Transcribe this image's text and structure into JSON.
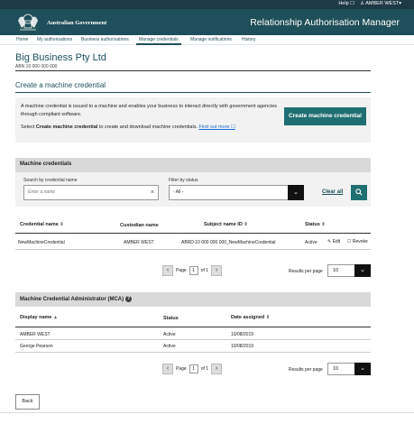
{
  "topbar": {
    "help": "Help ☐",
    "user": "♙ AMBER WEST▾"
  },
  "header": {
    "gov": "Australian Government",
    "title": "Relationship Authorisation Manager"
  },
  "nav": [
    "Home",
    "My authorisations",
    "Business authorisations",
    "Manage credentials",
    "Manage notifications",
    "History"
  ],
  "business": {
    "name": "Big Business Pty Ltd",
    "abn": "ABN 10 000 000 000"
  },
  "section_title": "Create a machine credential",
  "info": {
    "text1": "A machine credential is issued to a machine and enables your business to interact directly with government agencies through compliant software.",
    "text2_pre": "Select ",
    "text2_bold": "Create machine credential",
    "text2_post": " to create and download machine credentials. ",
    "link": "Find out more ☐",
    "button": "Create machine credential"
  },
  "machine_credentials": {
    "heading": "Machine credentials",
    "search_label": "Search by credential name",
    "search_placeholder": "Enter a name",
    "filter_label": "Filter by status",
    "filter_value": "- All -",
    "clear_all": "Clear all",
    "columns": [
      "Credential name",
      "Custodian name",
      "Subject name ID",
      "Status"
    ],
    "row": {
      "name": "NewMachineCredential",
      "custodian": "AMBER WEST",
      "subject": "ABRD:10 000 000 000_NewMachineCredential",
      "status": "Active",
      "edit": "✎ Edit",
      "revoke": "☐ Revoke"
    }
  },
  "pager": {
    "page_label": "Page",
    "page": "1",
    "of": "of 1",
    "rpp_label": "Results per page",
    "rpp": "10"
  },
  "mca": {
    "heading": "Machine Credential Administrator (MCA)",
    "columns": [
      "Display name",
      "Status",
      "Date assigned"
    ],
    "rows": [
      {
        "name": "AMBER WEST",
        "status": "Active",
        "date": "10/08/2019"
      },
      {
        "name": "George Pearson",
        "status": "Active",
        "date": "10/08/2019"
      }
    ]
  },
  "back": "Back",
  "colors": {
    "header": "#1f4f5a",
    "accent": "#1f6f73",
    "link": "#1f6ad6"
  }
}
